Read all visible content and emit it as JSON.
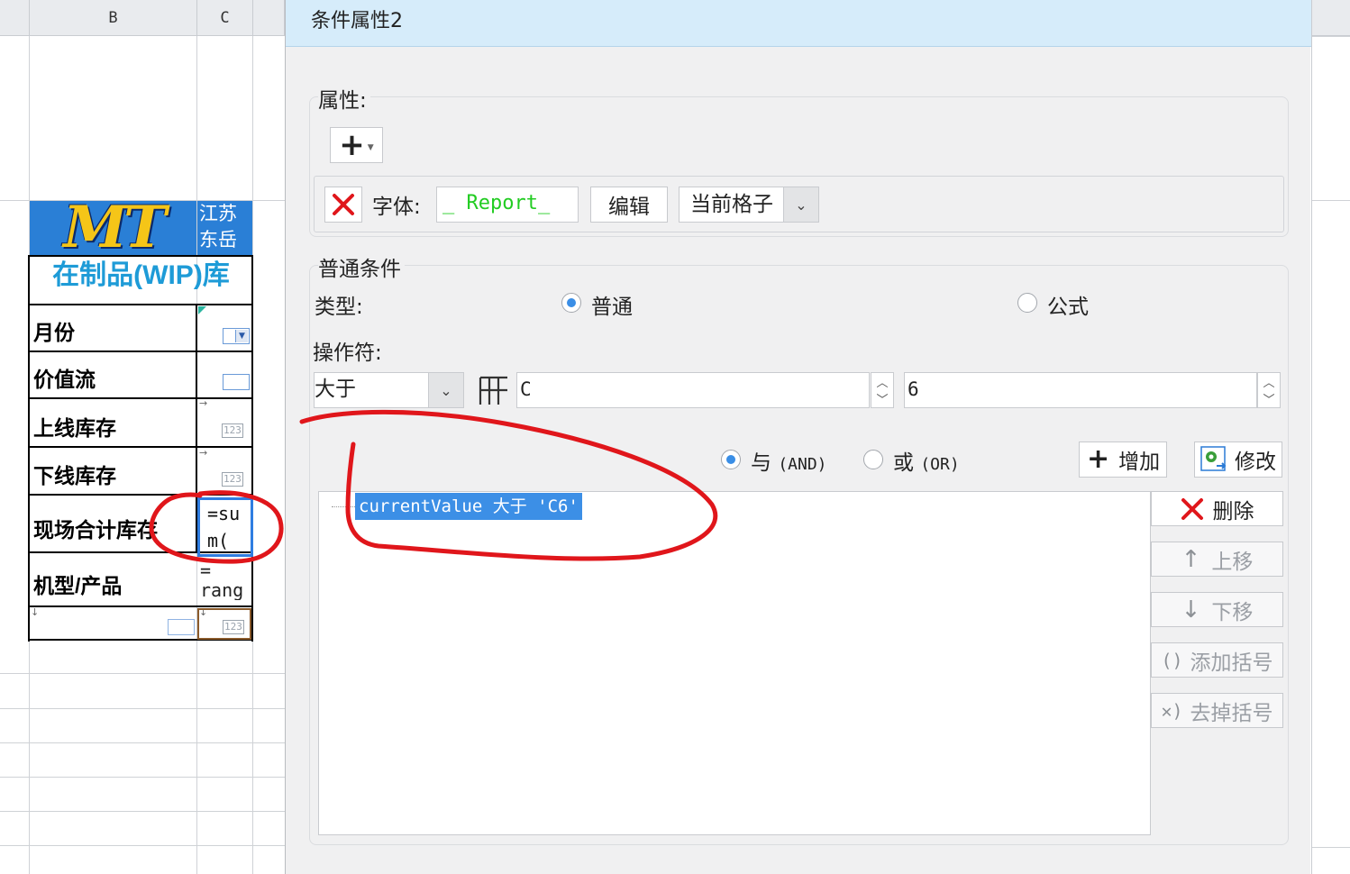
{
  "sheet": {
    "columns": [
      "B",
      "C"
    ],
    "logo_text": "MT",
    "company_text": "江苏东岳",
    "title_text": "在制品(WIP)库",
    "rows": [
      "月份",
      "价值流",
      "上线库存",
      "下线库存",
      "现场合计库存",
      "机型/产品"
    ],
    "formula_text": "=sum(",
    "range_text": "=\nrang",
    "num_badge": "123"
  },
  "dialog": {
    "title": "条件属性2",
    "properties": {
      "group_label": "属性:",
      "add_glyph": "+",
      "font_label": "字体:",
      "font_sample": "_ Report_",
      "edit_button": "编辑",
      "scope_value": "当前格子"
    },
    "condition": {
      "group_label": "普通条件",
      "type_label": "类型:",
      "type_options": [
        "普通",
        "公式"
      ],
      "type_selected": "普通",
      "operator_label": "操作符:",
      "operator_value": "大于",
      "column_value": "C",
      "row_value": "6",
      "and_label": "与",
      "and_sub": "(AND)",
      "or_label": "或",
      "or_sub": "(OR)",
      "logic_selected": "AND",
      "add_button": "增加",
      "modify_button": "修改",
      "delete_button": "删除",
      "move_up_button": "上移",
      "move_down_button": "下移",
      "add_bracket_button": "添加括号",
      "remove_bracket_button": "去掉括号",
      "conditions": [
        "currentValue 大于 'C6'"
      ]
    }
  },
  "colors": {
    "title_bar": "#d6ecfa",
    "selection": "#3c8fe6",
    "annotation": "#e0161b",
    "logo_bg": "#2a7fd6",
    "font_sample": "#22cc22"
  }
}
